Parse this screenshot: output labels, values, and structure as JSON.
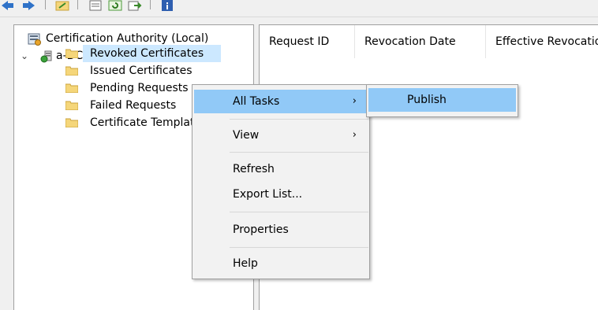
{
  "toolbar": {
    "buttons": [
      "back-icon",
      "forward-icon",
      "up-folder-icon",
      "properties-icon",
      "refresh-icon",
      "export-icon",
      "help-icon"
    ]
  },
  "tree": {
    "root_label": "Certification Authority (Local)",
    "ca_label": "a-DCA-CA",
    "items": [
      {
        "label": "Revoked Certificates"
      },
      {
        "label": "Issued Certificates"
      },
      {
        "label": "Pending Requests"
      },
      {
        "label": "Failed Requests"
      },
      {
        "label": "Certificate Templates"
      }
    ]
  },
  "list": {
    "columns": [
      "Request ID",
      "Revocation Date",
      "Effective Revocation Date"
    ]
  },
  "context_menu": {
    "items": [
      {
        "label": "All Tasks",
        "has_submenu": true
      },
      {
        "label": "View",
        "has_submenu": true
      },
      {
        "label": "Refresh"
      },
      {
        "label": "Export List..."
      },
      {
        "label": "Properties"
      },
      {
        "label": "Help"
      }
    ],
    "submenu_arrow": "›"
  },
  "submenu": {
    "items": [
      {
        "label": "Publish"
      }
    ]
  },
  "colors": {
    "selection": "#cce8ff",
    "menu_highlight": "#91c9f7",
    "folder": "#f5d67a"
  }
}
